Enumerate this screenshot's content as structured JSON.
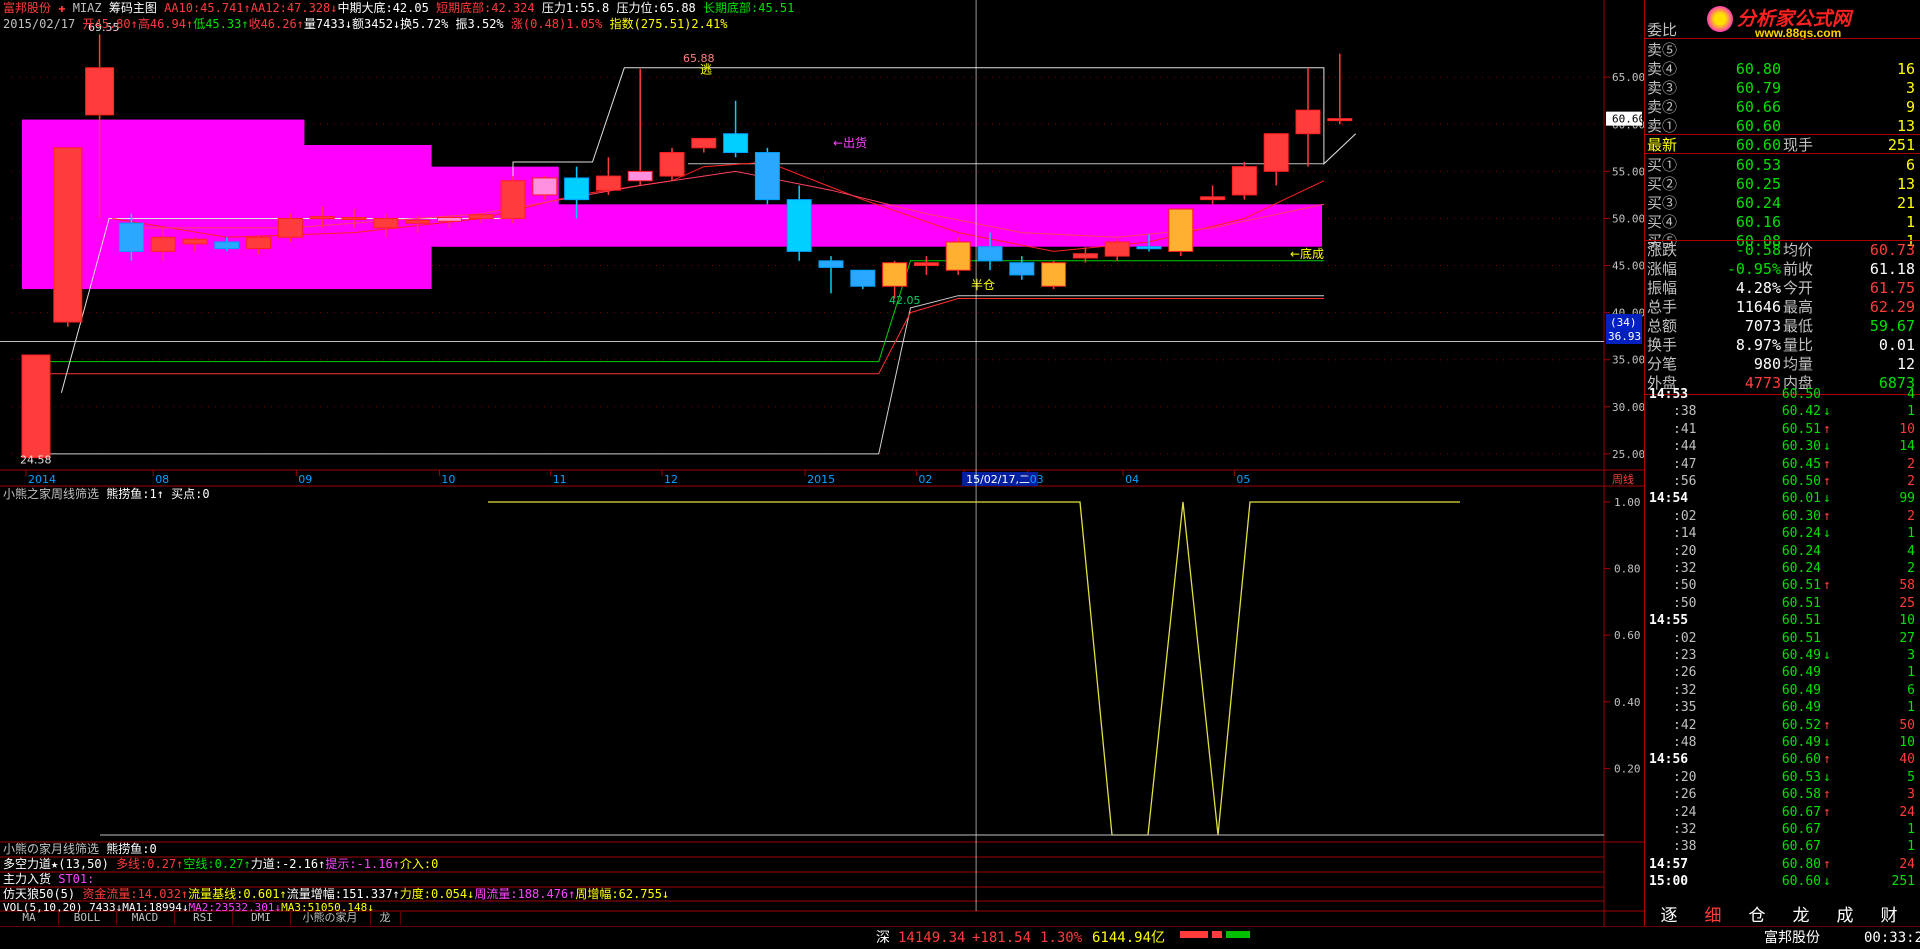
{
  "header": {
    "line1": [
      {
        "text": "富邦股份",
        "color": "#ff3c3c"
      },
      {
        "text": " ✚ ",
        "color": "#ff3c3c"
      },
      {
        "text": "MIAZ ",
        "color": "#c0c0c0"
      },
      {
        "text": "筹码主图 ",
        "color": "#ffffff"
      },
      {
        "text": "AA10:45.741↑",
        "color": "#ff3c3c"
      },
      {
        "text": "AA12:47.328↓",
        "color": "#ff3c3c"
      },
      {
        "text": "中期大底:42.05 ",
        "color": "#ffffff"
      },
      {
        "text": "短期底部:42.324 ",
        "color": "#ff3c3c"
      },
      {
        "text": "压力1:55.8 ",
        "color": "#ffffff"
      },
      {
        "text": "压力位:65.88 ",
        "color": "#ffffff"
      },
      {
        "text": "长期底部:45.51",
        "color": "#00e000"
      }
    ],
    "line2": [
      {
        "text": "2015/02/17 ",
        "color": "#c0c0c0"
      },
      {
        "text": "开45.80↑",
        "color": "#ff3c3c"
      },
      {
        "text": "高46.94↑",
        "color": "#ff3c3c"
      },
      {
        "text": "低45.33↑",
        "color": "#00e000"
      },
      {
        "text": "收46.26↑",
        "color": "#ff3c3c"
      },
      {
        "text": "量7433↓",
        "color": "#ffffff"
      },
      {
        "text": "额3452↓",
        "color": "#ffffff"
      },
      {
        "text": "换5.72% ",
        "color": "#ffffff"
      },
      {
        "text": "振3.52% ",
        "color": "#ffffff"
      },
      {
        "text": "涨(0.48)1.05% ",
        "color": "#ff3c3c"
      },
      {
        "text": "指数(275.51)2.41%",
        "color": "#ffff00"
      }
    ]
  },
  "chart_data": {
    "type": "candlestick",
    "period_label": "周线",
    "price_axis": {
      "ticks": [
        25,
        30,
        35,
        40,
        45,
        50,
        55,
        60,
        65
      ],
      "range": [
        23.5,
        69.8
      ]
    },
    "x_labels": [
      "2014",
      "08",
      "09",
      "10",
      "11",
      "12",
      "2015",
      "02",
      "15/02/17,二",
      "03",
      "04",
      "05"
    ],
    "current_price_tag": "60.60",
    "left_tag_1": "(34)",
    "left_tag_2": "36.93",
    "annotations": {
      "high_label": "69.55",
      "low_label": "24.58",
      "mid_high": "65.88",
      "mid_low": "42.05",
      "escape": "逃",
      "sell": "←出货",
      "half": "半仓",
      "bottom": "←底成"
    },
    "candles": [
      {
        "o": 24.6,
        "h": 35.5,
        "l": 24.6,
        "c": 35.5
      },
      {
        "o": 39.0,
        "h": 57.5,
        "l": 38.5,
        "c": 57.5
      },
      {
        "o": 61.0,
        "h": 69.55,
        "l": 50.0,
        "c": 66.0
      },
      {
        "o": 49.5,
        "h": 50.5,
        "l": 45.5,
        "c": 46.5
      },
      {
        "o": 46.5,
        "h": 49.0,
        "l": 45.5,
        "c": 48.0
      },
      {
        "o": 47.3,
        "h": 48.0,
        "l": 46.5,
        "c": 47.8
      },
      {
        "o": 47.5,
        "h": 48.0,
        "l": 46.5,
        "c": 46.8
      },
      {
        "o": 46.8,
        "h": 48.2,
        "l": 46.2,
        "c": 48.0
      },
      {
        "o": 48.0,
        "h": 50.5,
        "l": 47.5,
        "c": 50.0
      },
      {
        "o": 50.0,
        "h": 51.3,
        "l": 49.0,
        "c": 50.2
      },
      {
        "o": 50.0,
        "h": 51.0,
        "l": 49.0,
        "c": 50.1
      },
      {
        "o": 49.0,
        "h": 50.5,
        "l": 48.0,
        "c": 50.0
      },
      {
        "o": 49.5,
        "h": 50.3,
        "l": 48.5,
        "c": 49.8
      },
      {
        "o": 49.7,
        "h": 50.3,
        "l": 49.0,
        "c": 50.1
      },
      {
        "o": 50.0,
        "h": 50.5,
        "l": 49.5,
        "c": 50.4
      },
      {
        "o": 50.0,
        "h": 54.5,
        "l": 49.5,
        "c": 54.0
      },
      {
        "o": 52.5,
        "h": 54.5,
        "l": 52.0,
        "c": 54.3
      },
      {
        "o": 54.3,
        "h": 55.5,
        "l": 50.0,
        "c": 52.0
      },
      {
        "o": 53.0,
        "h": 56.5,
        "l": 52.5,
        "c": 54.5
      },
      {
        "o": 54.0,
        "h": 65.88,
        "l": 53.5,
        "c": 55.0
      },
      {
        "o": 54.5,
        "h": 57.5,
        "l": 54.0,
        "c": 57.0
      },
      {
        "o": 57.5,
        "h": 58.5,
        "l": 57.0,
        "c": 58.5
      },
      {
        "o": 59.0,
        "h": 62.5,
        "l": 56.5,
        "c": 57.0
      },
      {
        "o": 57.0,
        "h": 57.5,
        "l": 51.5,
        "c": 52.0
      },
      {
        "o": 52.0,
        "h": 53.5,
        "l": 45.5,
        "c": 46.5
      },
      {
        "o": 45.5,
        "h": 46.0,
        "l": 42.05,
        "c": 44.8
      },
      {
        "o": 44.5,
        "h": 44.5,
        "l": 42.5,
        "c": 42.8
      },
      {
        "o": 42.8,
        "h": 45.5,
        "l": 41.5,
        "c": 45.3
      },
      {
        "o": 45.0,
        "h": 46.0,
        "l": 44.0,
        "c": 45.3
      },
      {
        "o": 44.5,
        "h": 48.0,
        "l": 44.0,
        "c": 47.5
      },
      {
        "o": 47.0,
        "h": 48.5,
        "l": 44.5,
        "c": 45.5
      },
      {
        "o": 45.3,
        "h": 46.0,
        "l": 43.5,
        "c": 44.0
      },
      {
        "o": 42.8,
        "h": 45.5,
        "l": 42.5,
        "c": 45.3
      },
      {
        "o": 45.8,
        "h": 46.94,
        "l": 45.33,
        "c": 46.26
      },
      {
        "o": 46.0,
        "h": 47.8,
        "l": 45.5,
        "c": 47.5
      },
      {
        "o": 47.0,
        "h": 48.3,
        "l": 46.5,
        "c": 46.8
      },
      {
        "o": 46.5,
        "h": 51.0,
        "l": 46.0,
        "c": 51.0
      },
      {
        "o": 52.0,
        "h": 53.5,
        "l": 51.5,
        "c": 52.3
      },
      {
        "o": 52.5,
        "h": 56.0,
        "l": 52.0,
        "c": 55.5
      },
      {
        "o": 55.0,
        "h": 59.0,
        "l": 53.5,
        "c": 59.0
      },
      {
        "o": 59.0,
        "h": 66.0,
        "l": 55.5,
        "c": 61.5
      },
      {
        "o": 60.6,
        "h": 67.5,
        "l": 60.0,
        "c": 60.6
      }
    ],
    "sub_indicator": {
      "title": "小熊之家周线筛选",
      "label2": "熊捞鱼:1↑",
      "label3": "买点:0",
      "y_ticks": [
        0.2,
        0.4,
        0.6,
        0.8,
        1.0
      ],
      "y_tick_labels": [
        "0.20",
        "0.40",
        "0.60",
        "0.80",
        "1.00"
      ],
      "values": [
        1,
        1,
        1,
        1,
        1,
        1,
        1,
        1,
        1,
        1,
        1,
        1,
        1,
        1,
        1,
        1,
        1,
        1,
        1,
        1,
        1,
        1,
        1,
        1,
        1,
        1,
        1,
        1,
        1,
        1,
        1,
        1,
        1,
        1,
        1,
        1,
        0,
        0,
        1,
        0,
        1,
        1,
        1,
        1,
        1,
        1,
        1,
        1,
        1,
        1
      ]
    }
  },
  "bottom_lines": {
    "l1": [
      {
        "text": "小熊の家月线筛选 ",
        "color": "#c0c0c0"
      },
      {
        "text": "熊捞鱼:0",
        "color": "#ffffff"
      }
    ],
    "l2": [
      {
        "text": "多空力道★(13,50) ",
        "color": "#ffffff"
      },
      {
        "text": "多线:0.27↑",
        "color": "#ff3c3c"
      },
      {
        "text": "空线:0.27↑",
        "color": "#00e000"
      },
      {
        "text": "力道:-2.16↑",
        "color": "#ffffff"
      },
      {
        "text": "提示:-1.16↑",
        "color": "#ff44ff"
      },
      {
        "text": "介入:0",
        "color": "#ffff00"
      }
    ],
    "l3": [
      {
        "text": "主力入货 ",
        "color": "#ffffff"
      },
      {
        "text": "ST01:",
        "color": "#ff44ff"
      }
    ],
    "l4": [
      {
        "text": "仿天狼50(5) ",
        "color": "#ffffff"
      },
      {
        "text": "资金流量:14.032↑",
        "color": "#ff3c3c"
      },
      {
        "text": "流量基线:0.601↑",
        "color": "#ffff00"
      },
      {
        "text": "流量增幅:151.337↑",
        "color": "#ffffff"
      },
      {
        "text": "力度:0.054↓",
        "color": "#ffff00"
      },
      {
        "text": "周流量:188.476↑",
        "color": "#ff44ff"
      },
      {
        "text": "周增幅:62.755↓",
        "color": "#ffff00"
      }
    ],
    "l5": [
      {
        "text": "VOL(5,10,20) ",
        "color": "#ffffff"
      },
      {
        "text": "7433↓",
        "color": "#ffffff"
      },
      {
        "text": "MA1:18994↓",
        "color": "#ffffff"
      },
      {
        "text": "MA2:23532.301↓",
        "color": "#ff44ff"
      },
      {
        "text": "MA3:51050.148↓",
        "color": "#ffff00"
      }
    ]
  },
  "tabs": [
    "MA",
    "BOLL",
    "MACD",
    "RSI",
    "DMI",
    "小熊の家月",
    "龙"
  ],
  "quote": {
    "weibi": "委比",
    "sell": [
      {
        "label": "卖⑤",
        "price": "",
        "vol": ""
      },
      {
        "label": "卖④",
        "price": "60.80",
        "vol": "16"
      },
      {
        "label": "卖③",
        "price": "60.79",
        "vol": "3"
      },
      {
        "label": "卖②",
        "price": "60.66",
        "vol": "9"
      },
      {
        "label": "卖①",
        "price": "60.60",
        "vol": "13"
      }
    ],
    "latest": {
      "label": "最新",
      "price": "60.60",
      "label2": "现手",
      "vol": "251"
    },
    "buy": [
      {
        "label": "买①",
        "price": "60.53",
        "vol": "6"
      },
      {
        "label": "买②",
        "price": "60.25",
        "vol": "13"
      },
      {
        "label": "买③",
        "price": "60.24",
        "vol": "21"
      },
      {
        "label": "买④",
        "price": "60.16",
        "vol": "1"
      },
      {
        "label": "买⑤",
        "price": "60.08",
        "vol": "1"
      }
    ],
    "stats": [
      {
        "l1": "涨跌",
        "v1": "-0.58",
        "c1": "#00e000",
        "l2": "均价",
        "v2": "60.73",
        "c2": "#ff3c3c"
      },
      {
        "l1": "涨幅",
        "v1": "-0.95%",
        "c1": "#00e000",
        "l2": "前收",
        "v2": "61.18",
        "c2": "#ffffff"
      },
      {
        "l1": "振幅",
        "v1": "4.28%",
        "c1": "#ffffff",
        "l2": "今开",
        "v2": "61.75",
        "c2": "#ff3c3c"
      },
      {
        "l1": "总手",
        "v1": "11646",
        "c1": "#ffffff",
        "l2": "最高",
        "v2": "62.29",
        "c2": "#ff3c3c"
      },
      {
        "l1": "总额",
        "v1": "7073",
        "c1": "#ffffff",
        "l2": "最低",
        "v2": "59.67",
        "c2": "#00e000"
      },
      {
        "l1": "换手",
        "v1": "8.97%",
        "c1": "#ffffff",
        "l2": "量比",
        "v2": "0.01",
        "c2": "#ffffff"
      },
      {
        "l1": "分笔",
        "v1": "980",
        "c1": "#ffffff",
        "l2": "均量",
        "v2": "12",
        "c2": "#ffffff"
      },
      {
        "l1": "外盘",
        "v1": "4773",
        "c1": "#ff3c3c",
        "l2": "内盘",
        "v2": "6873",
        "c2": "#00e000"
      }
    ]
  },
  "ticks": [
    {
      "t": "14:53",
      "p": "60.50",
      "d": "",
      "v": "4",
      "pc": "#00e000",
      "vc": "#00e000"
    },
    {
      "t": ":38",
      "p": "60.42",
      "d": "↓",
      "v": "1",
      "pc": "#00e000",
      "vc": "#00e000"
    },
    {
      "t": ":41",
      "p": "60.51",
      "d": "↑",
      "v": "10",
      "pc": "#00e000",
      "vc": "#ff3c3c"
    },
    {
      "t": ":44",
      "p": "60.30",
      "d": "↓",
      "v": "14",
      "pc": "#00e000",
      "vc": "#00e000"
    },
    {
      "t": ":47",
      "p": "60.45",
      "d": "↑",
      "v": "2",
      "pc": "#00e000",
      "vc": "#ff3c3c"
    },
    {
      "t": ":56",
      "p": "60.50",
      "d": "↑",
      "v": "2",
      "pc": "#00e000",
      "vc": "#ff3c3c"
    },
    {
      "t": "14:54",
      "p": "60.01",
      "d": "↓",
      "v": "99",
      "pc": "#00e000",
      "vc": "#00e000"
    },
    {
      "t": ":02",
      "p": "60.30",
      "d": "↑",
      "v": "2",
      "pc": "#00e000",
      "vc": "#ff3c3c"
    },
    {
      "t": ":14",
      "p": "60.24",
      "d": "↓",
      "v": "1",
      "pc": "#00e000",
      "vc": "#00e000"
    },
    {
      "t": ":20",
      "p": "60.24",
      "d": "",
      "v": "4",
      "pc": "#00e000",
      "vc": "#00e000"
    },
    {
      "t": ":32",
      "p": "60.24",
      "d": "",
      "v": "2",
      "pc": "#00e000",
      "vc": "#00e000"
    },
    {
      "t": ":50",
      "p": "60.51",
      "d": "↑",
      "v": "58",
      "pc": "#00e000",
      "vc": "#ff3c3c"
    },
    {
      "t": ":50",
      "p": "60.51",
      "d": "",
      "v": "25",
      "pc": "#00e000",
      "vc": "#ff3c3c"
    },
    {
      "t": "14:55",
      "p": "60.51",
      "d": "",
      "v": "10",
      "pc": "#00e000",
      "vc": "#00e000"
    },
    {
      "t": ":02",
      "p": "60.51",
      "d": "",
      "v": "27",
      "pc": "#00e000",
      "vc": "#00e000"
    },
    {
      "t": ":23",
      "p": "60.49",
      "d": "↓",
      "v": "3",
      "pc": "#00e000",
      "vc": "#00e000"
    },
    {
      "t": ":26",
      "p": "60.49",
      "d": "",
      "v": "1",
      "pc": "#00e000",
      "vc": "#00e000"
    },
    {
      "t": ":32",
      "p": "60.49",
      "d": "",
      "v": "6",
      "pc": "#00e000",
      "vc": "#00e000"
    },
    {
      "t": ":35",
      "p": "60.49",
      "d": "",
      "v": "1",
      "pc": "#00e000",
      "vc": "#00e000"
    },
    {
      "t": ":42",
      "p": "60.52",
      "d": "↑",
      "v": "50",
      "pc": "#00e000",
      "vc": "#ff3c3c"
    },
    {
      "t": ":48",
      "p": "60.49",
      "d": "↓",
      "v": "10",
      "pc": "#00e000",
      "vc": "#00e000"
    },
    {
      "t": "14:56",
      "p": "60.60",
      "d": "↑",
      "v": "40",
      "pc": "#00e000",
      "vc": "#ff3c3c"
    },
    {
      "t": ":20",
      "p": "60.53",
      "d": "↓",
      "v": "5",
      "pc": "#00e000",
      "vc": "#00e000"
    },
    {
      "t": ":26",
      "p": "60.58",
      "d": "↑",
      "v": "3",
      "pc": "#00e000",
      "vc": "#ff3c3c"
    },
    {
      "t": ":24",
      "p": "60.67",
      "d": "↑",
      "v": "24",
      "pc": "#00e000",
      "vc": "#ff3c3c"
    },
    {
      "t": ":32",
      "p": "60.67",
      "d": "",
      "v": "1",
      "pc": "#00e000",
      "vc": "#00e000"
    },
    {
      "t": ":38",
      "p": "60.67",
      "d": "",
      "v": "1",
      "pc": "#00e000",
      "vc": "#00e000"
    },
    {
      "t": "14:57",
      "p": "60.80",
      "d": "↑",
      "v": "24",
      "pc": "#00e000",
      "vc": "#ff3c3c"
    },
    {
      "t": "15:00",
      "p": "60.60",
      "d": "↓",
      "v": "251",
      "pc": "#00e000",
      "vc": "#00e000"
    }
  ],
  "right_tabs": [
    "逐",
    "细",
    "仓",
    "龙",
    "成",
    "财"
  ],
  "logo": {
    "text": "分析家公式网",
    "url_text": "www.88gs.com"
  },
  "status": {
    "index_name": "深",
    "index_val": "14149.34",
    "index_chg": "+181.54",
    "index_pct": "1.30%",
    "amount": "6144.94亿",
    "stock": "富邦股份",
    "time": "00:33:2"
  },
  "colors": {
    "up": "#ff3c3c",
    "down": "#00d0ff",
    "magenta": "#ff00ff",
    "frame": "#a00000"
  }
}
